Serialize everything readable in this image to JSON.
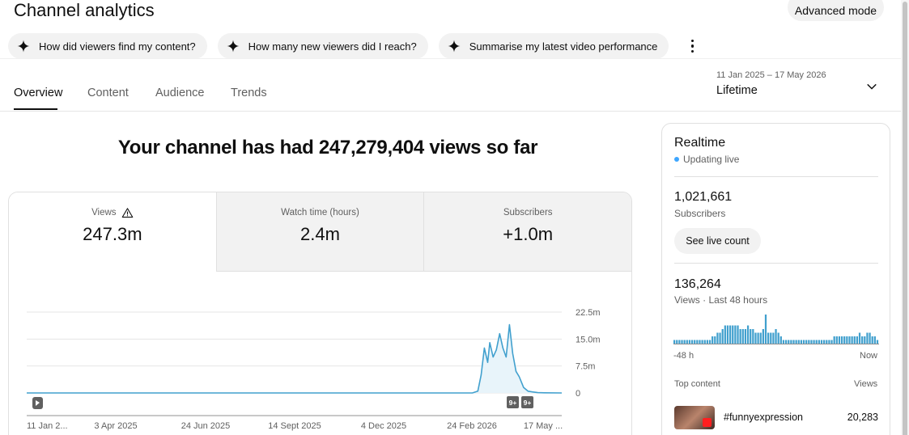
{
  "header": {
    "title": "Channel analytics",
    "advanced_mode": "Advanced mode"
  },
  "chips": [
    {
      "label": "How did viewers find my content?",
      "icon": "sparkle-icon"
    },
    {
      "label": "How many new viewers did I reach?",
      "icon": "sparkle-icon"
    },
    {
      "label": "Summarise my latest video performance",
      "icon": "sparkle-icon"
    }
  ],
  "tabs": [
    {
      "label": "Overview",
      "active": true
    },
    {
      "label": "Content",
      "active": false
    },
    {
      "label": "Audience",
      "active": false
    },
    {
      "label": "Trends",
      "active": false
    }
  ],
  "date_picker": {
    "range": "11 Jan 2025 – 17 May 2026",
    "label": "Lifetime"
  },
  "headline": "Your channel has had 247,279,404 views so far",
  "metrics": [
    {
      "label": "Views",
      "value": "247.3m",
      "warning": true
    },
    {
      "label": "Watch time (hours)",
      "value": "2.4m"
    },
    {
      "label": "Subscribers",
      "value": "+1.0m"
    }
  ],
  "chart": {
    "y_ticks": [
      "22.5m",
      "15.0m",
      "7.5m",
      "0"
    ],
    "x_ticks": [
      "11 Jan 2...",
      "3 Apr 2025",
      "24 Jun 2025",
      "14 Sept 2025",
      "4 Dec 2025",
      "24 Feb 2026",
      "17 May ..."
    ],
    "markers": [
      "9+",
      "9+"
    ],
    "line_color": "#41a0ce"
  },
  "chart_data": {
    "type": "area",
    "xlabel": "",
    "ylabel": "",
    "ylim": [
      0,
      22500000
    ],
    "x": [
      "2026-02-24",
      "2026-03-01",
      "2026-03-04",
      "2026-03-07",
      "2026-03-10",
      "2026-03-12",
      "2026-03-15",
      "2026-03-18",
      "2026-03-21",
      "2026-03-24",
      "2026-03-27",
      "2026-03-30",
      "2026-04-02",
      "2026-04-05",
      "2026-04-08",
      "2026-04-12",
      "2026-04-16",
      "2026-04-20",
      "2026-04-25",
      "2026-05-01",
      "2026-05-17"
    ],
    "series": [
      {
        "values": [
          0,
          500000,
          5000000,
          12500000,
          8500000,
          14000000,
          10000000,
          12000000,
          16500000,
          12500000,
          10000000,
          19000000,
          11000000,
          6000000,
          4500000,
          1500000,
          500000,
          300000,
          100000,
          50000,
          0
        ]
      }
    ],
    "grid": true
  },
  "realtime": {
    "title": "Realtime",
    "status": "Updating live",
    "subscribers_value": "1,021,661",
    "subscribers_label": "Subscribers",
    "live_count_button": "See live count",
    "views_value": "136,264",
    "views_label": "Views · Last 48 hours",
    "axis_start": "-48 h",
    "axis_end": "Now",
    "top_content_label": "Top content",
    "views_col_label": "Views",
    "bars": [
      1,
      1,
      1,
      1,
      1,
      1,
      1,
      1,
      1,
      1,
      1,
      1,
      1,
      1,
      1,
      2,
      2,
      3,
      3,
      4,
      5,
      5,
      5,
      5,
      5,
      5,
      4,
      4,
      4,
      5,
      4,
      4,
      3,
      3,
      3,
      4,
      8,
      3,
      3,
      3,
      4,
      3,
      2,
      1,
      1,
      1,
      1,
      1,
      1,
      1,
      1,
      1,
      1,
      1,
      1,
      1,
      1,
      1,
      1,
      1,
      1,
      1,
      1,
      2,
      2,
      2,
      2,
      2,
      2,
      2,
      2,
      2,
      2,
      3,
      2,
      2,
      3,
      3,
      2,
      2,
      1
    ],
    "top_item": {
      "title": "#funnyexpression",
      "views": "20,283"
    }
  }
}
